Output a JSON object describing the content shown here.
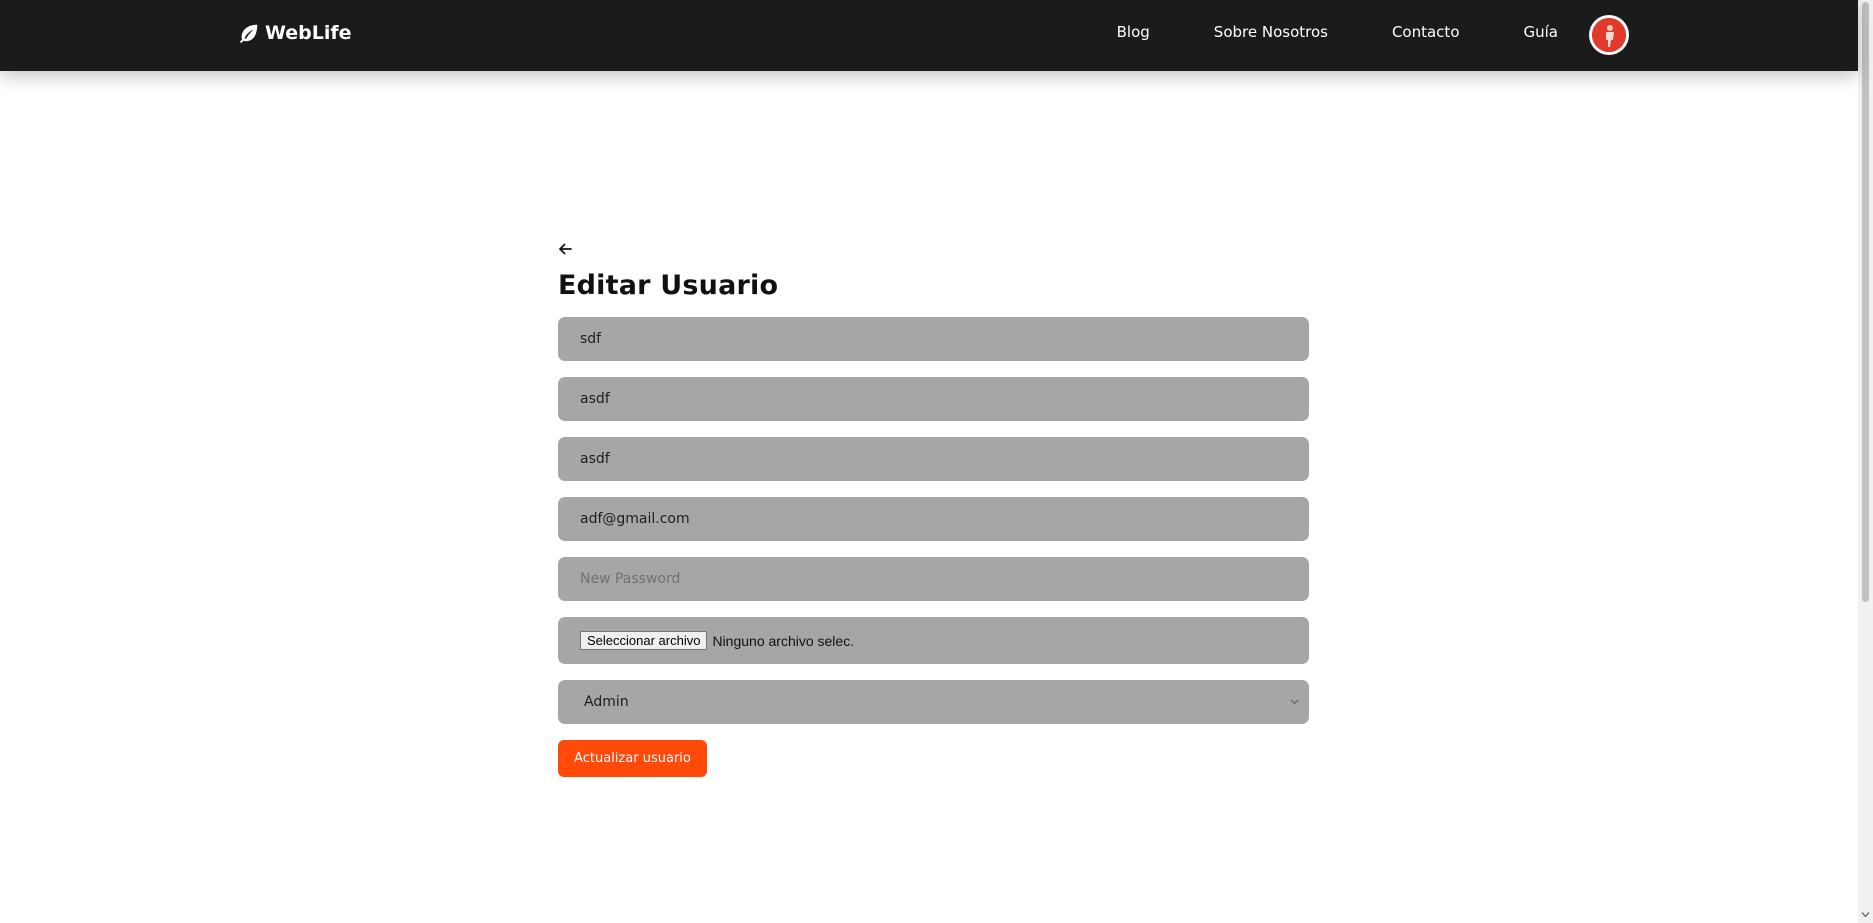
{
  "navbar": {
    "brand": "WebLife",
    "links": [
      "Blog",
      "Sobre Nosotros",
      "Contacto",
      "Guía"
    ]
  },
  "form": {
    "title": "Editar Usuario",
    "fields": {
      "field1": "sdf",
      "field2": "asdf",
      "field3": "asdf",
      "email": "adf@gmail.com",
      "password_placeholder": "New Password"
    },
    "file": {
      "button": "Seleccionar archivo",
      "status": "Ninguno archivo selec."
    },
    "role": {
      "selected": "Admin"
    },
    "submit": "Actualizar usuario"
  },
  "colors": {
    "nav_bg": "#1b1b1b",
    "field_bg": "#a6a6a6",
    "accent": "#ff4a0a"
  },
  "icons": {
    "brand": "leaf-icon",
    "back": "arrow-left-icon",
    "avatar": "avatar",
    "select": "chevron-down-icon"
  }
}
